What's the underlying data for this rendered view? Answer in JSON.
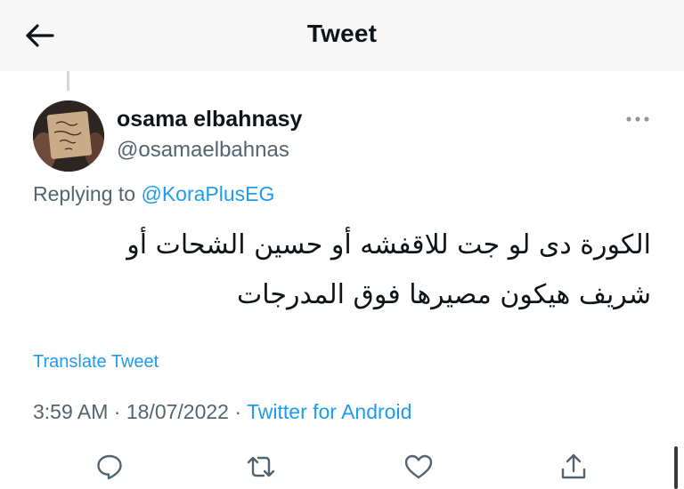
{
  "header": {
    "title": "Tweet"
  },
  "tweet": {
    "display_name": "osama elbahnasy",
    "handle": "@osamaelbahnas",
    "replying_prefix": "Replying to ",
    "replying_to": "@KoraPlusEG",
    "text_line1": "الكورة دى لو جت للاقفشه أو حسين الشحات أو",
    "text_line2": "شريف هيكون مصيرها فوق المدرجات",
    "translate_label": "Translate Tweet",
    "time": "3:59 AM",
    "separator": " · ",
    "date": "18/07/2022",
    "source": "Twitter for Android"
  },
  "icons": {
    "back": "arrow-left-icon",
    "more": "more-horizontal-icon",
    "reply": "reply-icon",
    "retweet": "retweet-icon",
    "like": "heart-icon",
    "share": "share-icon"
  },
  "colors": {
    "accent": "#1d9bf0",
    "secondary_text": "#536471",
    "primary_text": "#0f1419",
    "header_bg": "#f7f7f7"
  }
}
